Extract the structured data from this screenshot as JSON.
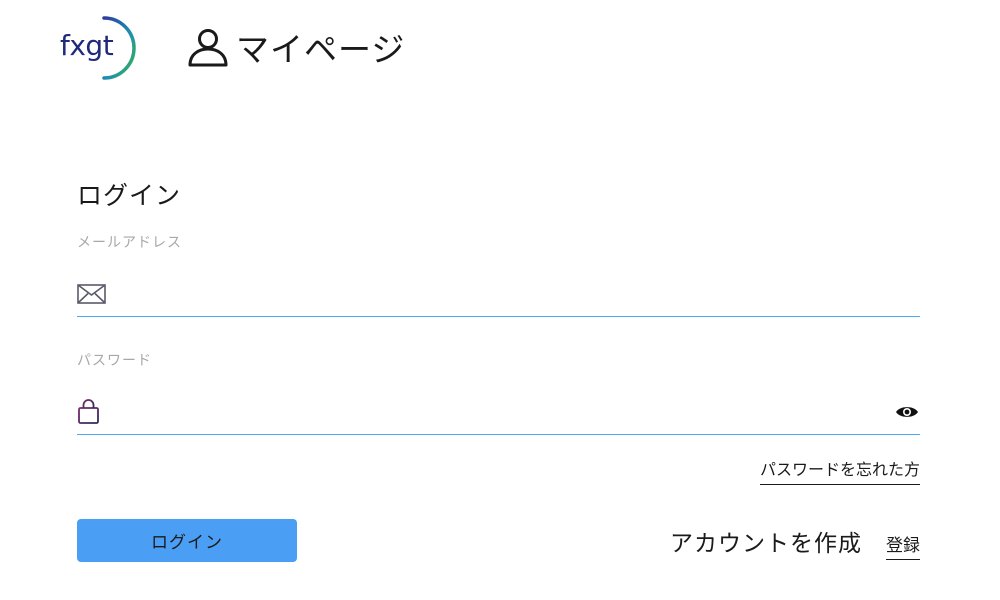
{
  "header": {
    "logo_text": "fxgt",
    "mypage_label": "マイページ"
  },
  "login_form": {
    "title": "ログイン",
    "email": {
      "label": "メールアドレス",
      "value": "",
      "icon": "envelope-icon"
    },
    "password": {
      "label": "パスワード",
      "value": "",
      "icon": "lock-icon",
      "toggle_icon": "eye-icon"
    },
    "forgot_password_label": "パスワードを忘れた方",
    "login_button_label": "ログイン"
  },
  "create_account": {
    "label": "アカウントを作成",
    "register_label": "登録"
  },
  "colors": {
    "accent": "#4a9ff5",
    "field_underline": "#4ea7f5",
    "logo_text": "#1f2a7a",
    "logo_ring_start": "#2e3a9e",
    "logo_ring_end": "#3bb54a"
  }
}
